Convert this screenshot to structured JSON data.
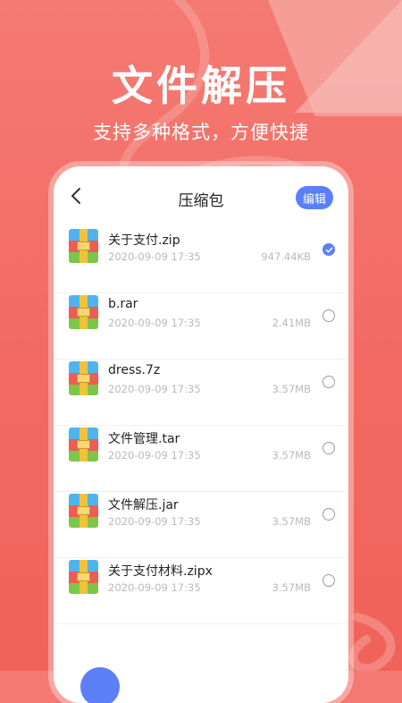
{
  "hero": {
    "title": "文件解压",
    "subtitle": "支持多种格式，方便快捷"
  },
  "nav": {
    "title": "压缩包",
    "edit_label": "编辑"
  },
  "files": [
    {
      "name": "关于支付.zip",
      "date": "2020-09-09 17:35",
      "size": "947.44KB",
      "checked": true
    },
    {
      "name": "b.rar",
      "date": "2020-09-09 17:35",
      "size": "2.41MB",
      "checked": false
    },
    {
      "name": "dress.7z",
      "date": "2020-09-09 17:35",
      "size": "3.57MB",
      "checked": false
    },
    {
      "name": "文件管理.tar",
      "date": "2020-09-09 17:35",
      "size": "3.57MB",
      "checked": false
    },
    {
      "name": "文件解压.jar",
      "date": "2020-09-09 17:35",
      "size": "3.57MB",
      "checked": false
    },
    {
      "name": "关于支付材料.zipx",
      "date": "2020-09-09 17:35",
      "size": "3.57MB",
      "checked": false
    }
  ],
  "colors": {
    "background": "#f26a62",
    "accent": "#5b7ff6"
  },
  "icons": {
    "back": "chevron-left-icon",
    "file": "archive-icon",
    "check": "check-icon"
  }
}
